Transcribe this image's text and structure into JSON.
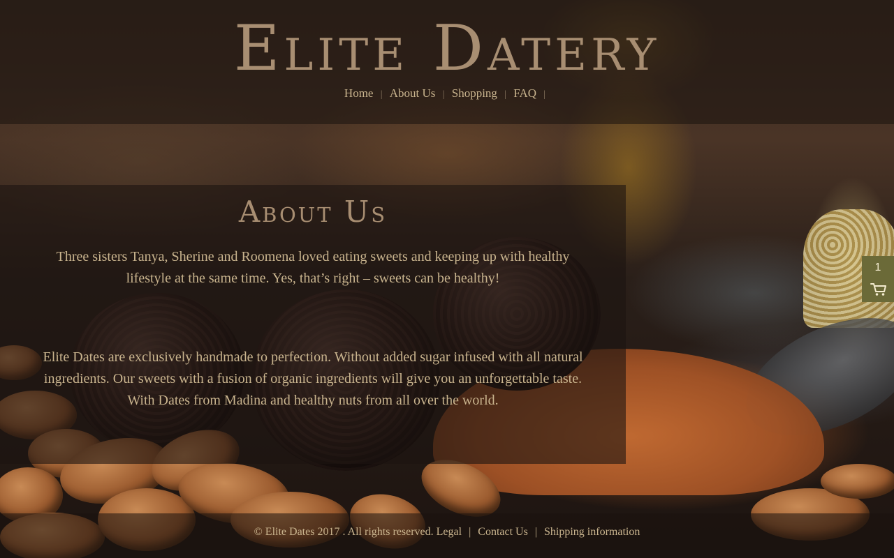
{
  "header": {
    "logo_text": "Elite Datery",
    "nav": {
      "items": [
        {
          "label": "Home"
        },
        {
          "label": "About Us"
        },
        {
          "label": "Shopping"
        },
        {
          "label": "FAQ"
        }
      ],
      "separator": "|"
    }
  },
  "about": {
    "title": "About Us",
    "paragraphs": [
      "Three sisters Tanya, Sherine and Roomena loved eating sweets and keeping up with healthy lifestyle at the same time. Yes, that’s right – sweets can be healthy!",
      "Elite Dates are exclusively handmade to perfection. Without added sugar infused with all natural ingredients. Our sweets with a fusion of organic ingredients will give you an unforgettable taste. With Dates from Madina and healthy nuts from all over the world."
    ]
  },
  "cart": {
    "count": "1",
    "icon": "shopping-cart-icon"
  },
  "footer": {
    "copyright": "© Elite Dates 2017 . All rights reserved.",
    "links": {
      "legal": "Legal",
      "contact": "Contact Us",
      "shipping": "Shipping information"
    },
    "separator": "|"
  },
  "colors": {
    "accent_text": "#c9b48e",
    "logo": "#a88e72",
    "cart_bg": "#6b6a38"
  }
}
